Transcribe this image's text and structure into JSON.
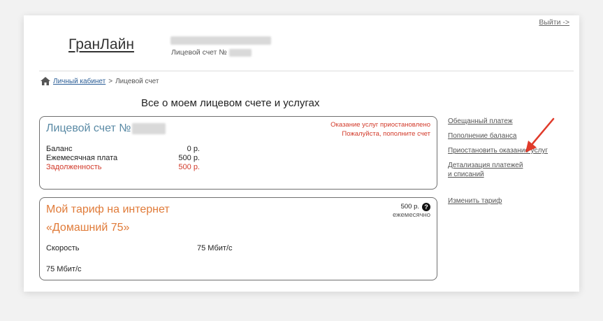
{
  "header": {
    "logout_label": "Выйти ->",
    "logo_text": "ГранЛайн",
    "account_label": "Лицевой счет №"
  },
  "breadcrumb": {
    "home_label": "Личный кабинет",
    "separator": ">",
    "current": "Лицевой счет"
  },
  "page_title": "Все о моем лицевом счете и услугах",
  "account_box": {
    "title": "Лицевой счет №",
    "notice_line1": "Оказание услуг приостановлено",
    "notice_line2": "Пожалуйста, пополните счет",
    "rows": [
      {
        "label": "Баланс",
        "value": "0 р."
      },
      {
        "label": "Ежемесячная плата",
        "value": "500 р."
      },
      {
        "label": "Задолженность",
        "value": "500 р."
      }
    ]
  },
  "tariff_box": {
    "heading": "Мой тариф на интернет",
    "name": "«Домашний 75»",
    "price": "500 р.",
    "period": "ежемесячно",
    "speed_label": "Скорость",
    "speed_value": "75 Мбит/с",
    "extra_line": "75 Мбит/с"
  },
  "side_links": {
    "promised_payment": "Обещанный платеж",
    "top_up": "Пополнение баланса",
    "suspend": "Приостановить оказание услуг",
    "details_line1": "Детализация платежей",
    "details_line2": "и списаний",
    "change_tariff": "Изменить тариф"
  },
  "colors": {
    "accent_orange": "#e07b39",
    "alert_red": "#d23a2a",
    "account_blue": "#5a8aa5",
    "link_blue": "#2a5d96"
  },
  "icons": {
    "home": "home-icon",
    "help": "question-circle-icon",
    "annotation": "red-arrow-icon"
  }
}
